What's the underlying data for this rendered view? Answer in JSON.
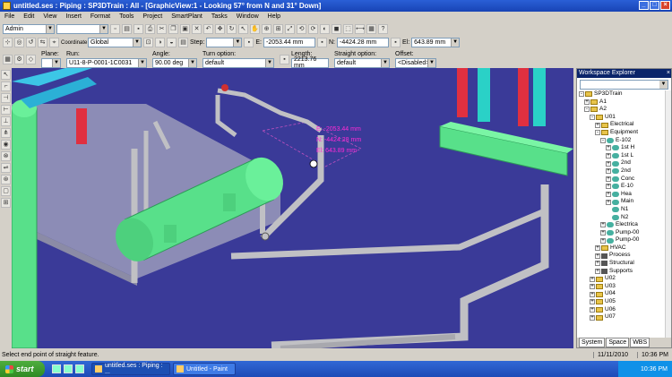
{
  "window": {
    "title": "untitled.ses : Piping : SP3DTrain : All - [GraphicView:1 - Looking 57° from N and 31° Down]"
  },
  "menu": [
    "File",
    "Edit",
    "View",
    "Insert",
    "Format",
    "Tools",
    "Project",
    "SmartPlant",
    "Tasks",
    "Window",
    "Help"
  ],
  "toolbar1": {
    "permission": "Admin",
    "second_combo": ""
  },
  "toolbar2": {
    "coord_label": "Coordinate system:",
    "coord_value": "Global",
    "step_label": "Step:",
    "step_value": "",
    "e_label": "E:",
    "e_value": "-2053.44 mm",
    "n_label": "N:",
    "n_value": "-4424.28 mm",
    "el_label": "El:",
    "el_value": "643.89 mm"
  },
  "ribbon": {
    "plane_label": "Plane:",
    "plane_value": "",
    "run_label": "Run:",
    "run_value": "U11-8-P-0001-1C0031",
    "angle_label": "Angle:",
    "angle_value": "90.00 deg",
    "turn_label": "Turn option:",
    "turn_value": "default",
    "length_label": "Length:",
    "length_value": "2213.76 mm",
    "straight_label": "Straight option:",
    "straight_value": "default",
    "offset_label": "Offset:",
    "offset_value": "<Disabled>"
  },
  "readout": {
    "e": "E: -2053.44 mm",
    "n": "N: -4424.28 mm",
    "el": "El: 643.89 mm"
  },
  "workspace": {
    "title": "Workspace Explorer",
    "tabs": [
      "System",
      "Space",
      "WBS"
    ],
    "tree": [
      {
        "label": "SP3DTrain",
        "depth": 0,
        "pm": "-",
        "icon": "folder"
      },
      {
        "label": "A1",
        "depth": 1,
        "pm": "+",
        "icon": "folder"
      },
      {
        "label": "A2",
        "depth": 1,
        "pm": "-",
        "icon": "folder"
      },
      {
        "label": "U01",
        "depth": 2,
        "pm": "-",
        "icon": "folder"
      },
      {
        "label": "Electrical",
        "depth": 3,
        "pm": "+",
        "icon": "folder"
      },
      {
        "label": "Equipment",
        "depth": 3,
        "pm": "-",
        "icon": "folder"
      },
      {
        "label": "E-102",
        "depth": 4,
        "pm": "-",
        "icon": "equip"
      },
      {
        "label": "1st H",
        "depth": 5,
        "pm": "+",
        "icon": "equip"
      },
      {
        "label": "1st L",
        "depth": 5,
        "pm": "+",
        "icon": "equip"
      },
      {
        "label": "2nd",
        "depth": 5,
        "pm": "+",
        "icon": "equip"
      },
      {
        "label": "2nd",
        "depth": 5,
        "pm": "+",
        "icon": "equip"
      },
      {
        "label": "Conc",
        "depth": 5,
        "pm": "+",
        "icon": "equip"
      },
      {
        "label": "E-10",
        "depth": 5,
        "pm": "+",
        "icon": "equip"
      },
      {
        "label": "Hea",
        "depth": 5,
        "pm": "+",
        "icon": "equip"
      },
      {
        "label": "Main",
        "depth": 5,
        "pm": "+",
        "icon": "equip"
      },
      {
        "label": "N1",
        "depth": 5,
        "pm": "",
        "icon": "nozzle"
      },
      {
        "label": "N2",
        "depth": 5,
        "pm": "",
        "icon": "nozzle"
      },
      {
        "label": "Electrica",
        "depth": 4,
        "pm": "+",
        "icon": "equip"
      },
      {
        "label": "Pump-00",
        "depth": 4,
        "pm": "+",
        "icon": "equip"
      },
      {
        "label": "Pump-00",
        "depth": 4,
        "pm": "+",
        "icon": "equip"
      },
      {
        "label": "HVAC",
        "depth": 3,
        "pm": "+",
        "icon": "folder"
      },
      {
        "label": "Process",
        "depth": 3,
        "pm": "+",
        "icon": "sys"
      },
      {
        "label": "Structural",
        "depth": 3,
        "pm": "+",
        "icon": "sys"
      },
      {
        "label": "Supports",
        "depth": 3,
        "pm": "+",
        "icon": "sys"
      },
      {
        "label": "U02",
        "depth": 2,
        "pm": "+",
        "icon": "folder"
      },
      {
        "label": "U03",
        "depth": 2,
        "pm": "+",
        "icon": "folder"
      },
      {
        "label": "U04",
        "depth": 2,
        "pm": "+",
        "icon": "folder"
      },
      {
        "label": "U05",
        "depth": 2,
        "pm": "+",
        "icon": "folder"
      },
      {
        "label": "U06",
        "depth": 2,
        "pm": "+",
        "icon": "folder"
      },
      {
        "label": "U07",
        "depth": 2,
        "pm": "+",
        "icon": "folder"
      }
    ]
  },
  "status": {
    "message": "Select end point of straight feature.",
    "date": "11/11/2010",
    "time": "10:36 PM"
  },
  "taskbar": {
    "start": "start",
    "tasks": [
      "untitled.ses : Piping : ...",
      "Untitled - Paint"
    ],
    "clock": "10:36 PM"
  },
  "colors": {
    "viewport_bg": "#3a3a98",
    "equipment": "#58e08a",
    "pipe": "#b8b8bc",
    "readout": "#ff2bd6",
    "selected_box": "#a020a0"
  }
}
